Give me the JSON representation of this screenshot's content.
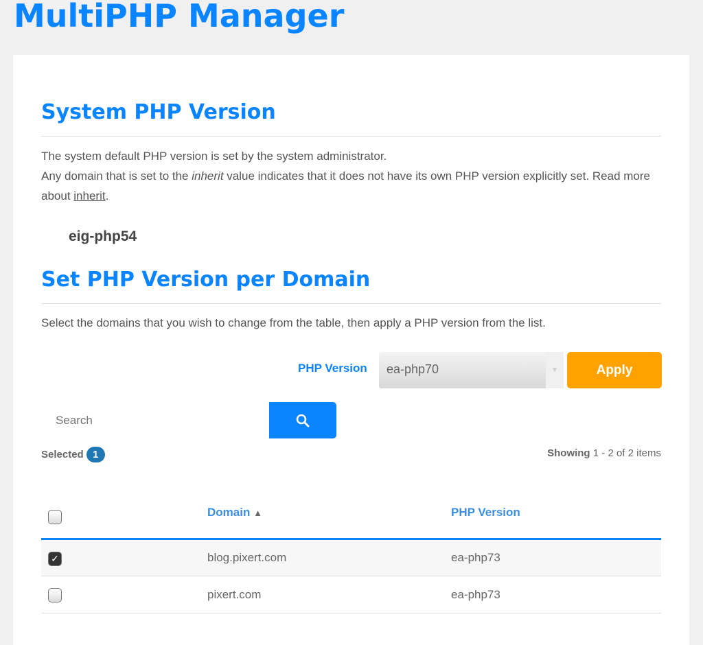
{
  "app_title": "MultiPHP Manager",
  "system": {
    "heading": "System PHP Version",
    "line1": "The system default PHP version is set by the system administrator.",
    "line2_a": "Any domain that is set to the ",
    "line2_em": "inherit",
    "line2_b": " value indicates that it does not have its own PHP version explicitly set. Read more about ",
    "link": "inherit",
    "line2_c": ".",
    "version": "eig-php54"
  },
  "per_domain": {
    "heading": "Set PHP Version per Domain",
    "description": "Select the domains that you wish to change from the table, then apply a PHP version from the list.",
    "php_label": "PHP Version",
    "selected_version": "ea-php70",
    "apply_label": "Apply",
    "search_placeholder": "Search",
    "selected_label": "Selected",
    "selected_count": "1",
    "showing_label": "Showing",
    "showing_range": "1 - 2 of 2 items"
  },
  "table": {
    "columns": [
      "Domain",
      "PHP Version"
    ],
    "sort_indicator": "▲",
    "rows": [
      {
        "domain": "blog.pixert.com",
        "version": "ea-php73",
        "checked": true
      },
      {
        "domain": "pixert.com",
        "version": "ea-php73",
        "checked": false
      }
    ]
  },
  "colors": {
    "accent": "#0a84ff",
    "apply": "#ffa200",
    "badge": "#1f77b4"
  }
}
